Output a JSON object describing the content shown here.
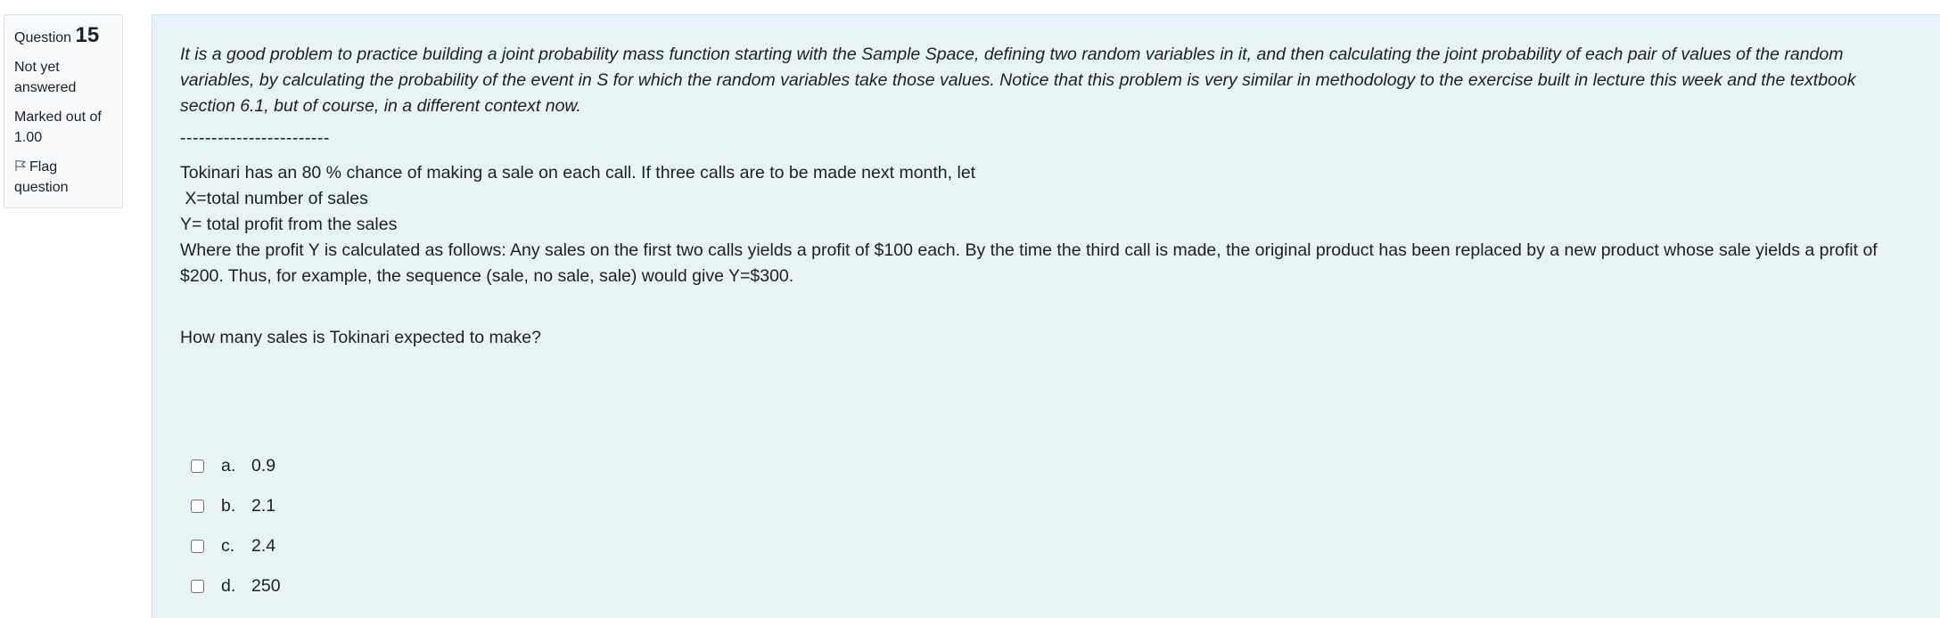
{
  "info": {
    "question_word": "Question",
    "question_number": "15",
    "state": "Not yet answered",
    "grade": "Marked out of 1.00",
    "flag_label": "Flag question"
  },
  "content": {
    "intro": " It is a good problem to practice building a joint probability mass function starting with the Sample Space, defining two random variables in it, and then calculating the joint probability of each pair of values of the random variables, by calculating the probability of the event in S for which the random variables take those values. Notice that this problem is very similar in methodology to the exercise built in lecture this week and the textbook section 6.1, but of course, in a different context now.",
    "dashes": "------------------------",
    "line1": "Tokinari has an 80 % chance of making a sale on each call. If three calls are to be made next month, let",
    "line2": " X=total number of sales",
    "line3": "Y= total profit from the sales",
    "line4": "Where the profit Y is calculated as follows: Any sales on the first two calls yields a profit of $100 each. By the time the third call is made, the original product has been replaced by a new product whose sale yields a profit of $200. Thus, for example, the sequence (sale, no sale, sale) would give Y=$300.",
    "question": "How many sales is Tokinari expected to make?"
  },
  "answers": [
    {
      "letter": "a.",
      "text": "0.9"
    },
    {
      "letter": "b.",
      "text": "2.1"
    },
    {
      "letter": "c.",
      "text": "2.4"
    },
    {
      "letter": "d.",
      "text": "250"
    }
  ]
}
